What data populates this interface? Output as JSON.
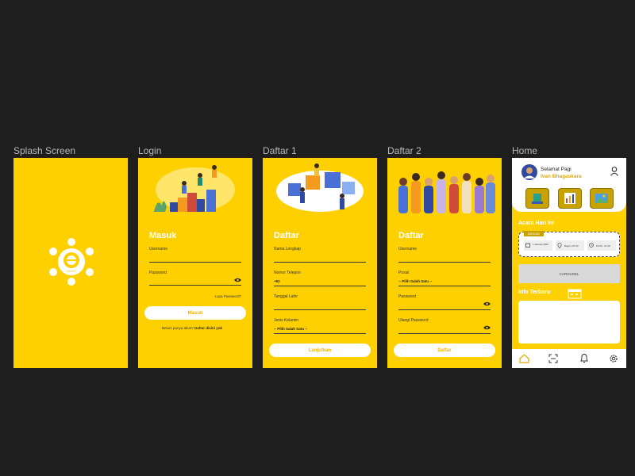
{
  "frames": {
    "splash": {
      "label": "Splash Screen",
      "logo_text": "BOOK"
    },
    "login": {
      "label": "Login",
      "title": "Masuk",
      "username_label": "Username",
      "password_label": "Password",
      "forgot": "Lupa Password?",
      "button": "Masuk",
      "signup_prompt": "Belum punya akun?",
      "signup_link": "Daftar disini yuk"
    },
    "daftar1": {
      "label": "Daftar 1",
      "title": "Daftar",
      "name_label": "Nama Lengkap",
      "phone_label": "Nomor Telepon",
      "phone_value": "+62",
      "birth_label": "Tanggal Lahir",
      "gender_label": "Jenis Kelamin",
      "gender_value": "-- Pilih Salah Satu --",
      "button": "Lanjutkan"
    },
    "daftar2": {
      "label": "Daftar 2",
      "title": "Daftar",
      "username_label": "Username",
      "position_label": "Posisi",
      "position_value": "-- Pilih Salah Satu --",
      "password_label": "Password",
      "repeat_label": "Ulangi Password",
      "button": "Daftar"
    },
    "home": {
      "label": "Home",
      "greeting": "Selamat Pagi",
      "user": "Ivan Bhagaskara",
      "today_title": "Acara Hari Ini",
      "event_tag": "ARISAN",
      "event_date": "1 Januari 2022",
      "event_place": "Bogor, RT 04",
      "event_time": "19.00 - 21.00",
      "carousel": "CAROUSEL",
      "info_title": "Info Terbaru"
    }
  },
  "colors": {
    "background": "#1e1e1e",
    "accent": "#ffd000",
    "button_text": "#f5b400"
  },
  "icons": [
    "home-icon",
    "scan-icon",
    "bell-icon",
    "gear-icon",
    "user-icon",
    "eye-icon",
    "calendar-icon",
    "location-icon",
    "clock-icon"
  ]
}
